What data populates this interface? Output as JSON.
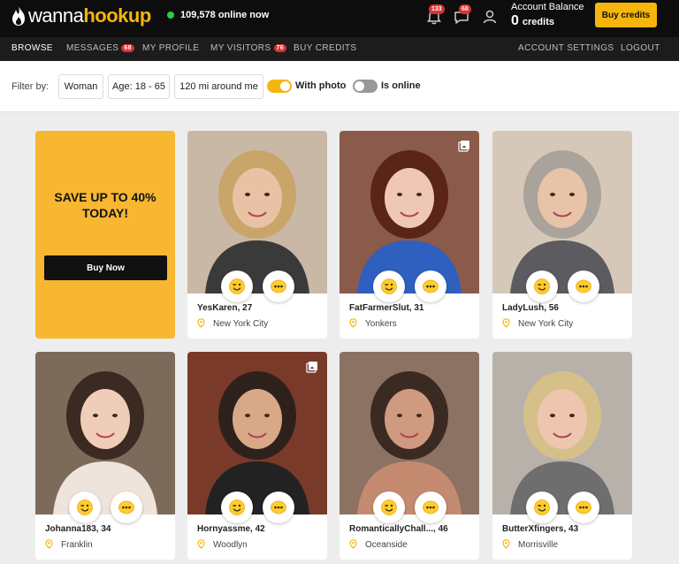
{
  "brand": {
    "logo_part1": "wanna",
    "logo_part2": "hookup"
  },
  "header": {
    "online_count": "109,578 online now",
    "notifications_badge": "133",
    "messages_badge": "68",
    "balance_label": "Account Balance",
    "balance_amount": "0",
    "balance_unit": "credits",
    "buy_credits": "Buy credits"
  },
  "nav": {
    "browse": "BROWSE",
    "messages": "MESSAGES",
    "messages_badge": "68",
    "my_profile": "MY PROFILE",
    "my_visitors": "MY VISITORS",
    "visitors_badge": "76",
    "buy_credits": "BUY CREDITS",
    "account_settings": "ACCOUNT SETTINGS",
    "logout": "LOGOUT"
  },
  "filters": {
    "label": "Filter by:",
    "gender": "Woman",
    "age": "Age: 18 - 65",
    "distance": "120 mi around me",
    "with_photo": "With photo",
    "with_photo_on": true,
    "is_online": "Is online",
    "is_online_on": false
  },
  "promo": {
    "line1": "SAVE UP TO 40%",
    "line2": "TODAY!",
    "button": "Buy Now"
  },
  "colors": {
    "accent": "#f5b50d",
    "header_bg": "#0d0d0d",
    "nav_bg": "#1c1c1c",
    "badge": "#e03131",
    "online": "#2ecc40"
  },
  "profiles": [
    {
      "name": "YesKaren, 27",
      "city": "New York City"
    },
    {
      "name": "FatFarmerSlut, 31",
      "city": "Yonkers"
    },
    {
      "name": "LadyLush, 56",
      "city": "New York City"
    },
    {
      "name": "Johanna183, 34",
      "city": "Franklin"
    },
    {
      "name": "Hornyassme, 42",
      "city": "Woodlyn"
    },
    {
      "name": "RomanticallyChall..., 46",
      "city": "Oceanside"
    },
    {
      "name": "ButterXfingers, 43",
      "city": "Morrisville"
    }
  ]
}
